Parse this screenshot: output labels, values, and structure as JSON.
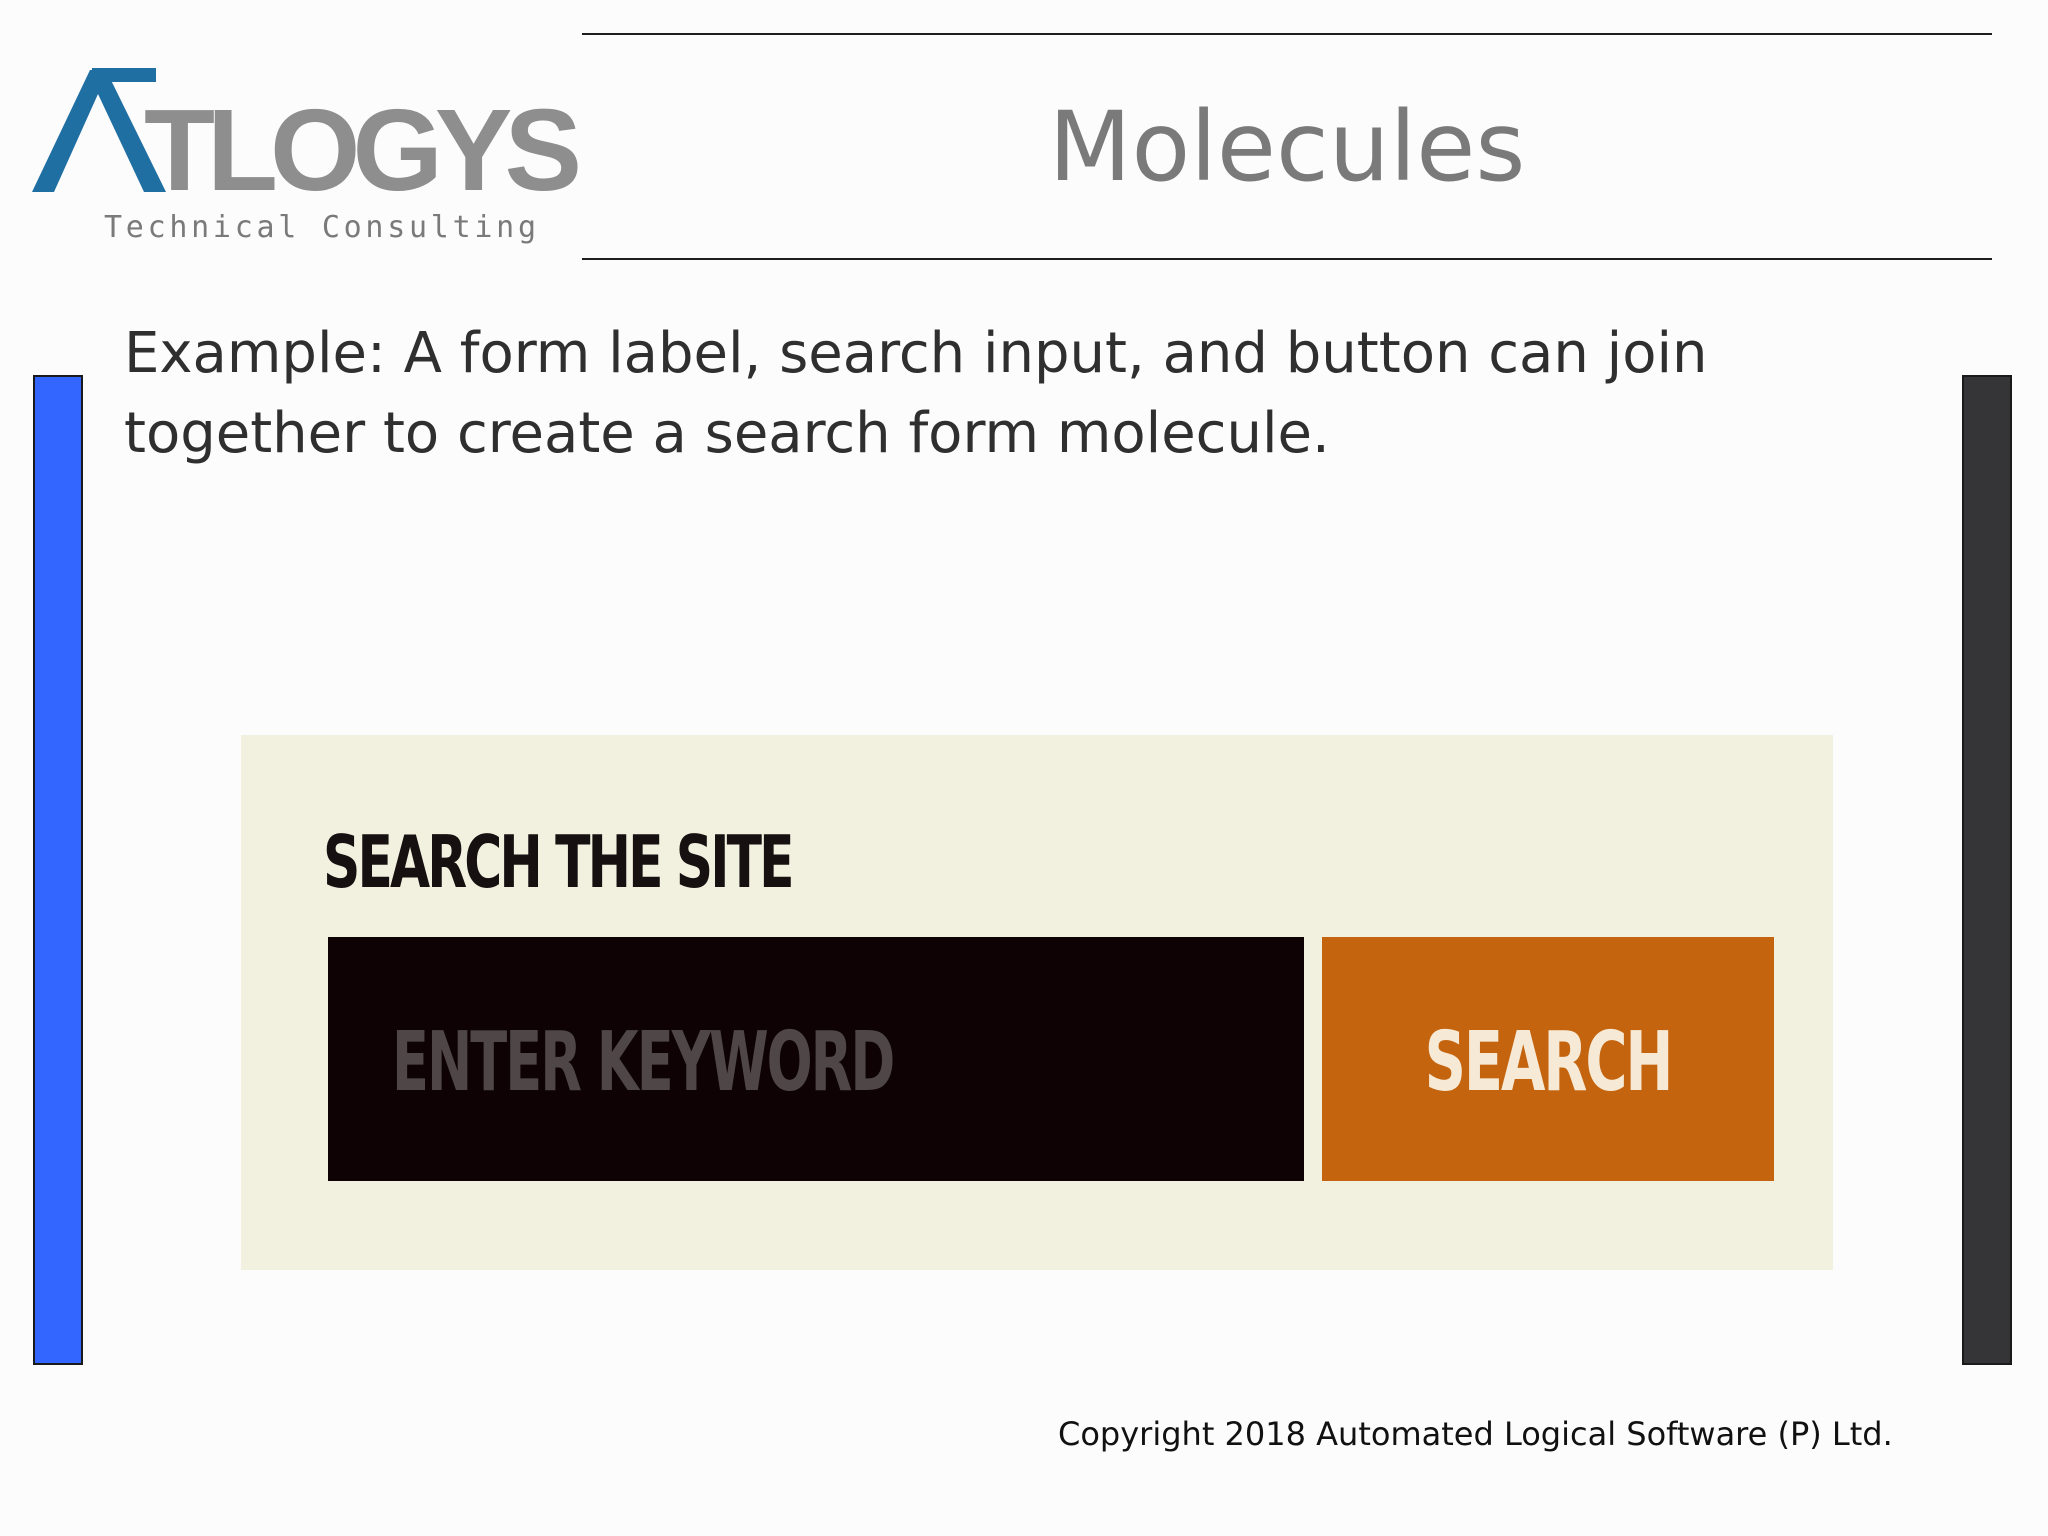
{
  "slide": {
    "title": "Molecules",
    "body": "Example: A form label, search input, and button can join together to create a search form molecule.",
    "copyright": "Copyright 2018 Automated Logical Software (P) Ltd."
  },
  "logo": {
    "wordmark": "ATLOGYS",
    "tagline": "Technical Consulting",
    "accent_color": "#1f6fa3",
    "gray_color": "#8e8e8e"
  },
  "example": {
    "label": "SEARCH THE SITE",
    "input_placeholder": "ENTER KEYWORD",
    "button_label": "SEARCH",
    "input_color": "#0e0204",
    "button_color": "#c4640e",
    "background_color": "#f2f0de"
  },
  "colors": {
    "left_bar": "#3366ff",
    "right_bar": "#353537",
    "title": "#7a7a7a"
  }
}
